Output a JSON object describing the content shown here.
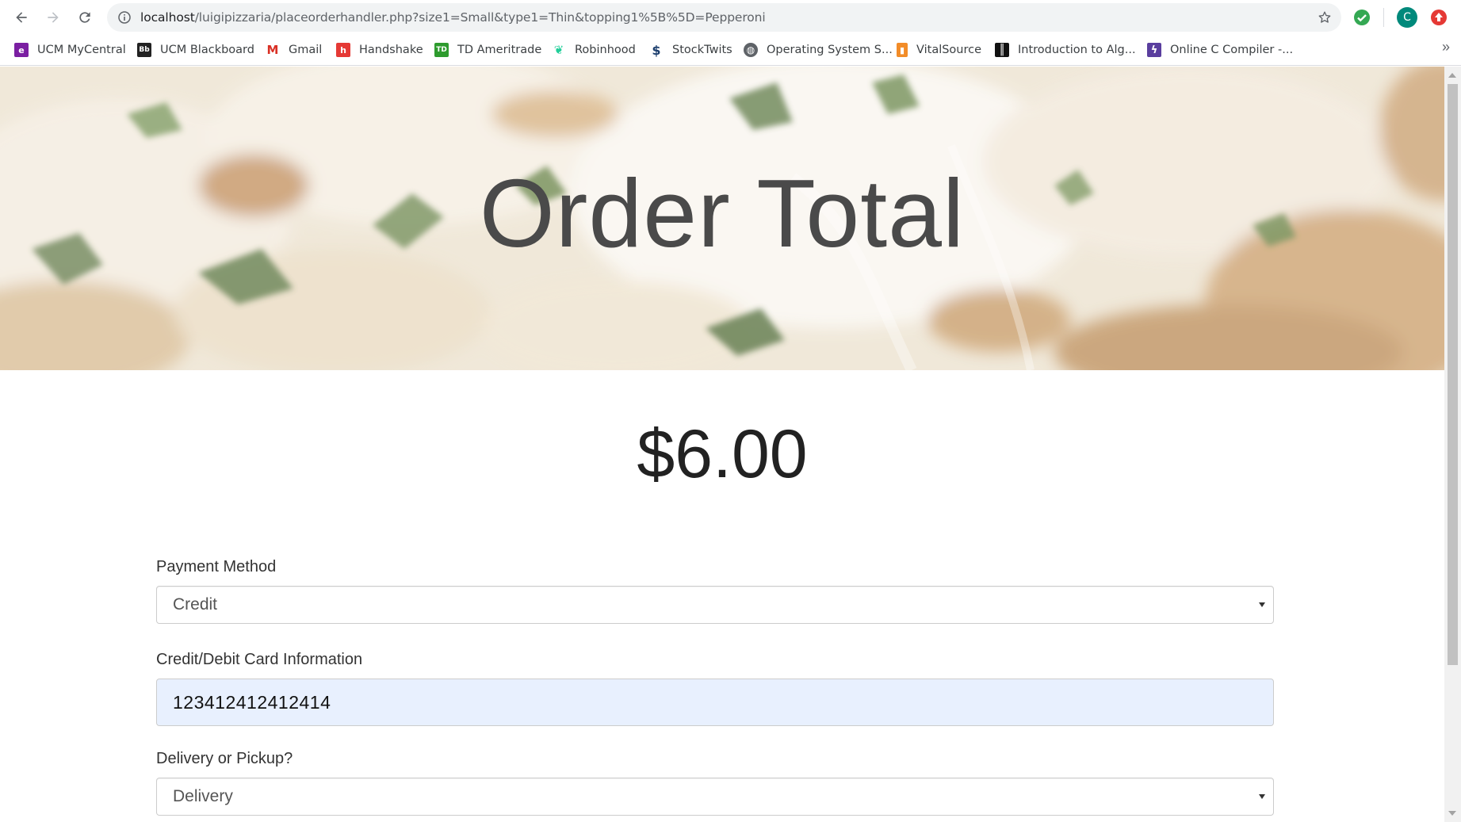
{
  "browser": {
    "url_host": "localhost",
    "url_path": "/luigipizzaria/placeorderhandler.php?size1=Small&type1=Thin&topping1%5B%5D=Pepperoni",
    "profile_initial": "C",
    "bookmarks": [
      {
        "label": "UCM MyCentral",
        "icon": "ucm-icon",
        "color": "#7b1fa2",
        "glyph": "e"
      },
      {
        "label": "UCM Blackboard",
        "icon": "blackboard-icon",
        "color": "#222222",
        "glyph": "Bb"
      },
      {
        "label": "Gmail",
        "icon": "gmail-icon",
        "color": "#ffffff",
        "glyph": "M"
      },
      {
        "label": "Handshake",
        "icon": "handshake-icon",
        "color": "#e53935",
        "glyph": "h"
      },
      {
        "label": "TD Ameritrade",
        "icon": "td-icon",
        "color": "#2e9b2e",
        "glyph": "TD"
      },
      {
        "label": "Robinhood",
        "icon": "robinhood-icon",
        "color": "#ffffff",
        "glyph": "❦"
      },
      {
        "label": "StockTwits",
        "icon": "stocktwits-icon",
        "color": "#ffffff",
        "glyph": "$"
      },
      {
        "label": "Operating System S...",
        "icon": "globe-icon",
        "color": "#5f6368",
        "glyph": "◍"
      },
      {
        "label": "VitalSource",
        "icon": "vitalsource-icon",
        "color": "#f28c28",
        "glyph": "▮"
      },
      {
        "label": "Introduction to Alg...",
        "icon": "barcode-icon",
        "color": "#111111",
        "glyph": "║"
      },
      {
        "label": "Online C Compiler -...",
        "icon": "compiler-icon",
        "color": "#5a3e9e",
        "glyph": "ϟ"
      }
    ],
    "more_label": "»"
  },
  "hero": {
    "title": "Order Total"
  },
  "order": {
    "total": "$6.00"
  },
  "form": {
    "payment_label": "Payment Method",
    "payment_value": "Credit",
    "card_label": "Credit/Debit Card Information",
    "card_value": "123412412412414",
    "delivery_label": "Delivery or Pickup?",
    "delivery_value": "Delivery"
  }
}
